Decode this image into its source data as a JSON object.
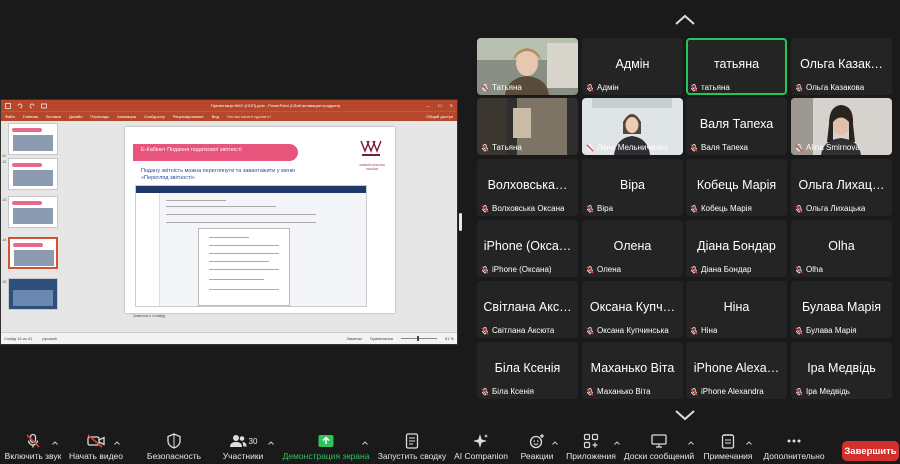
{
  "share": {
    "titlebar": {
      "doc_title": "Презентація ЖКУ (НОП).pptx - PowerPoint (Сбой активации продукта)",
      "share_label": "Общий доступ"
    },
    "ribbon": [
      "Файл",
      "Главная",
      "Вставка",
      "Дизайн",
      "Переходы",
      "Анимация",
      "Слайд-шоу",
      "Рецензирование",
      "Вид"
    ],
    "tell_me": "Что вы хотите сделать?",
    "thumb_numbers": [
      "11",
      "12",
      "13",
      "14",
      "15"
    ],
    "slide": {
      "banner": "Е-Кабінет Подання податкової звітності",
      "logo_text": "ЖИВОЙ ПОКОЛІН УКРАЇНИ",
      "text_line1": "Подану звітність можна переглянути та завантажити у меню",
      "text_line2": "«Перегляд звітності»"
    },
    "notes": "Заметки к слайду",
    "status": {
      "slide": "Слайд 14 из 41",
      "lang": "русский",
      "notes_btn": "Заметки",
      "comments_btn": "Примечания",
      "zoom": "51 %"
    }
  },
  "gallery": {
    "tiles": [
      {
        "big": "",
        "name": "Татьяна",
        "video": "webcam-woman"
      },
      {
        "big": "Адмін",
        "name": "Адмін"
      },
      {
        "big": "татьяна",
        "name": "татьяна",
        "active": true
      },
      {
        "big": "Ольга Казак…",
        "name": "Ольга Казакова"
      },
      {
        "big": "",
        "name": "Татьяна",
        "video": "webcam-blur"
      },
      {
        "big": "",
        "name": "Лена Мельниченко",
        "video": "webcam-girl"
      },
      {
        "big": "Валя Тапеха",
        "name": "Валя Тапеха"
      },
      {
        "big": "",
        "name": "Alina Smirnova",
        "video": "webcam-dark-hair"
      },
      {
        "big": "Волховська…",
        "name": "Волховська Оксана"
      },
      {
        "big": "Віра",
        "name": "Віра"
      },
      {
        "big": "Кобець Марія",
        "name": "Кобець Марія"
      },
      {
        "big": "Ольга Лихац…",
        "name": "Ольга Лихацька"
      },
      {
        "big": "iPhone (Окса…",
        "name": "iPhone (Оксана)"
      },
      {
        "big": "Олена",
        "name": "Олена"
      },
      {
        "big": "Діана Бондар",
        "name": "Діана Бондар"
      },
      {
        "big": "Olha",
        "name": "Olha"
      },
      {
        "big": "Світлана Акс…",
        "name": "Світлана Аксюта"
      },
      {
        "big": "Оксана Купч…",
        "name": "Оксана Купчинська"
      },
      {
        "big": "Ніна",
        "name": "Ніна"
      },
      {
        "big": "Булава Марія",
        "name": "Булава Марія"
      },
      {
        "big": "Біла Ксенія",
        "name": "Біла Ксенія"
      },
      {
        "big": "Маханько Віта",
        "name": "Маханько Віта"
      },
      {
        "big": "iPhone Alexa…",
        "name": "iPhone Alexandra"
      },
      {
        "big": "Іра Медвідь",
        "name": "Іра Медвідь"
      }
    ]
  },
  "toolbar": {
    "mute": "Включить звук",
    "video": "Начать видео",
    "security": "Безопасность",
    "participants": "Участники",
    "participants_count": "30",
    "share": "Демонстрация экрана",
    "summary": "Запустить сводку",
    "ai": "AI Companion",
    "reactions": "Реакции",
    "apps": "Приложения",
    "whiteboards": "Доски сообщений",
    "notes": "Примечания",
    "more": "Дополнительно",
    "end": "Завершить",
    "accent_green": "#2ec45c",
    "end_color": "#d32f2f"
  }
}
